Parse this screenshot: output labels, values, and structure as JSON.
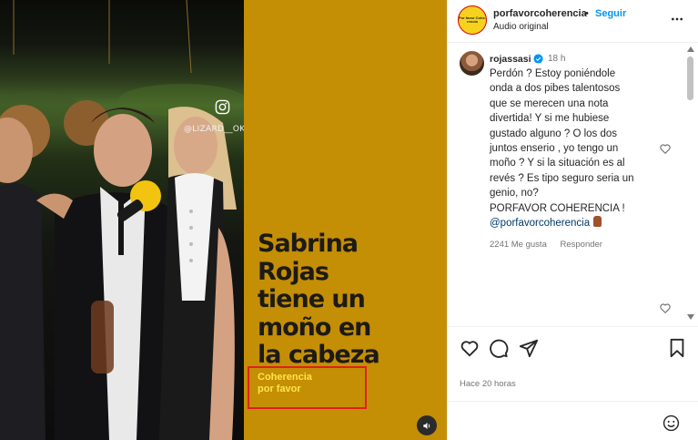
{
  "media": {
    "photo_credit": "@LIZARD__OK",
    "headline_lines": [
      "Sabrina",
      "Rojas",
      "tiene un",
      "moño en",
      "la cabeza"
    ],
    "subtitle_lines": [
      "Coherencia",
      "por favor"
    ],
    "colors": {
      "panel": "#c48e05",
      "headline": "#1c1a14",
      "subtitle": "#ffe44a",
      "highlight_box": "#e02020"
    }
  },
  "post_header": {
    "avatar_text": "Por favor Cohe-rencia",
    "username": "porfavorcoherencia",
    "separator": "•",
    "follow_label": "Seguir",
    "audio": "Audio original"
  },
  "comment": {
    "username": "rojassasi",
    "time": "18 h",
    "lines": [
      "Perdón ? Estoy poniéndole",
      "onda a dos pibes talentosos",
      "que se merecen una nota",
      "divertida! Y si me hubiese",
      "gustado alguno ? O los dos",
      "juntos enserio , yo tengo un",
      "moño ? Y si la situación es al",
      "revés ? Es tipo seguro seria un",
      "genio, no?",
      "PORFAVOR COHERENCIA !"
    ],
    "mention": "@porfavorcoherencia",
    "likes": "2241 Me gusta",
    "reply": "Responder"
  },
  "footer": {
    "time_ago": "Hace 20 horas"
  },
  "icons": {
    "instagram": "instagram-icon",
    "sound": "speaker-icon",
    "more": "more-horizontal-icon",
    "verified": "verified-badge-icon",
    "like": "heart-icon",
    "comment": "comment-bubble-icon",
    "share": "paper-plane-icon",
    "save": "bookmark-icon",
    "emoji": "smiley-icon"
  },
  "colors": {
    "link": "#0095f6",
    "mention": "#00376b",
    "muted": "#737373"
  }
}
